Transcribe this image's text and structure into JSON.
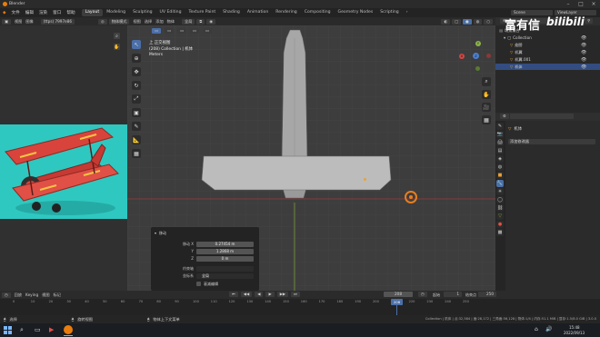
{
  "window": {
    "title": "Blender"
  },
  "menu": {
    "file_items": [
      "文件",
      "编辑",
      "渲染",
      "窗口",
      "帮助"
    ],
    "tabs": [
      "Layout",
      "Modeling",
      "Sculpting",
      "UV Editing",
      "Texture Paint",
      "Shading",
      "Animation",
      "Rendering",
      "Compositing",
      "Geometry Nodes",
      "Scripting"
    ],
    "active_tab": "Layout",
    "scene_label": "Scene",
    "viewlayer_label": "ViewLayer"
  },
  "left_header": {
    "mode": "物体",
    "view": "视图",
    "image": "图像",
    "image_name": "(ttps) 7997e86"
  },
  "viewport_header": {
    "mode": "物体模式",
    "view": "视图",
    "select": "选择",
    "add": "添加",
    "object": "物体",
    "transform": "全局"
  },
  "viewport_info": {
    "view_name": "上 正交视图",
    "collection": "(208) Collection | 机体",
    "units": "Meters"
  },
  "gizmo": {
    "x": "X",
    "y": "Y",
    "z": "Z"
  },
  "operator_panel": {
    "title": "移动",
    "move_x_label": "移动 X",
    "move_x": "0.27454 m",
    "y_label": "Y",
    "y": "1.2868 m",
    "z_label": "Z",
    "z": "0 m",
    "orient_label": "坐标系",
    "orient": "全局",
    "constraint_label": "约束轴",
    "proportional_label": "衰减编辑"
  },
  "outliner": {
    "title": "场景集合",
    "rows": [
      "Collection",
      "翅膀",
      "机翼",
      "机翼.001",
      "机体"
    ],
    "selected": "机体"
  },
  "properties": {
    "object_name": "机体",
    "modifier_add": "添加修改器"
  },
  "timeline": {
    "menu": [
      "回放",
      "Keying",
      "视图",
      "标记"
    ],
    "current_frame": "208",
    "start_label": "起始",
    "start": "1",
    "end_label": "结束点",
    "end": "250",
    "ticks": [
      "0",
      "10",
      "20",
      "30",
      "40",
      "50",
      "60",
      "70",
      "80",
      "90",
      "100",
      "110",
      "120",
      "130",
      "140",
      "150",
      "160",
      "170",
      "180",
      "190",
      "200",
      "210",
      "220",
      "230",
      "240",
      "250"
    ]
  },
  "status": {
    "select": "选择",
    "rotate": "旋转视图",
    "context": "物体上下文菜单",
    "stats": "Collection | 机体 | 点:32,584 | 面:28,172 | 三角面:56,128 | 物体:1/4 | 内存:51.1 MiB | 显存:1.5/8.0 GiB | 3.0.0"
  },
  "taskbar": {
    "time": "15:48",
    "date": "2022/09/13"
  },
  "watermark": {
    "text": "富有信",
    "brand": "bilibili"
  },
  "colors": {
    "accent": "#4b6fa8",
    "origin": "#e8a13a",
    "x_axis": "#d04646",
    "y_axis": "#8ab34a",
    "plane_body": "#d8443c",
    "plane_bg": "#2ec8c0"
  }
}
